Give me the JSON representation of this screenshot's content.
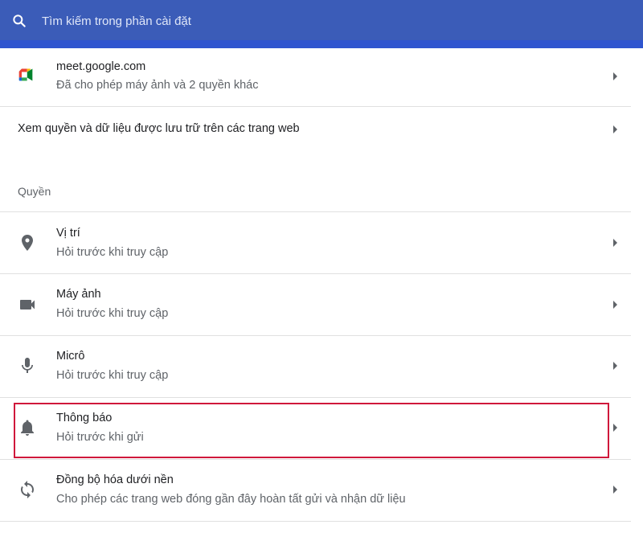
{
  "search": {
    "placeholder": "Tìm kiếm trong phần cài đặt",
    "icon": "search-icon"
  },
  "site": {
    "title": "meet.google.com",
    "subtitle": "Đã cho phép máy ảnh và 2 quyền khác",
    "icon": "google-meet-icon"
  },
  "view_all_permissions": {
    "label": "Xem quyền và dữ liệu được lưu trữ trên các trang web"
  },
  "permissions": {
    "heading": "Quyền",
    "items": [
      {
        "title": "Vị trí",
        "subtitle": "Hỏi trước khi truy cập",
        "icon": "location-pin-icon"
      },
      {
        "title": "Máy ảnh",
        "subtitle": "Hỏi trước khi truy cập",
        "icon": "video-camera-icon"
      },
      {
        "title": "Micrô",
        "subtitle": "Hỏi trước khi truy cập",
        "icon": "microphone-icon"
      },
      {
        "title": "Thông báo",
        "subtitle": "Hỏi trước khi gửi",
        "icon": "bell-icon",
        "highlighted": true
      },
      {
        "title": "Đồng bộ hóa dưới nền",
        "subtitle": "Cho phép các trang web đóng gần đây hoàn tất gửi và nhận dữ liệu",
        "icon": "sync-icon"
      }
    ]
  },
  "colors": {
    "header": "#3b5cb8",
    "header_strip": "#2f55cf",
    "highlight_border": "#d0183b",
    "icon_gray": "#5f6368"
  }
}
